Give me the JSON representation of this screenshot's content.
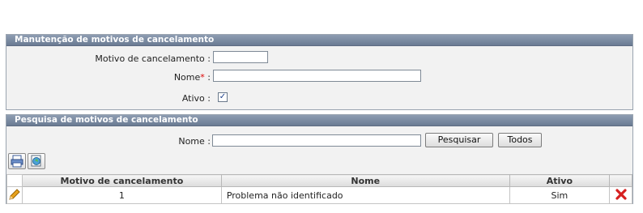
{
  "maintenance": {
    "title": "Manutenção de motivos de cancelamento",
    "motivo_label": "Motivo de cancelamento :",
    "motivo_value": "",
    "nome_label": "Nome",
    "required_mark": "*",
    "nome_colon": ":",
    "nome_value": "",
    "ativo_label": "Ativo :",
    "ativo_checked": true
  },
  "search": {
    "title": "Pesquisa de motivos de cancelamento",
    "nome_label": "Nome :",
    "nome_value": "",
    "search_button": "Pesquisar",
    "all_button": "Todos"
  },
  "toolbar": {
    "icons": [
      "print-icon",
      "export-icon"
    ]
  },
  "table": {
    "headers": [
      "Motivo de cancelamento",
      "Nome",
      "Ativo"
    ],
    "rows": [
      {
        "motivo": "1",
        "nome": "Problema não identificado",
        "ativo": "Sim"
      }
    ]
  },
  "colors": {
    "panel_header": "#7a8aa2",
    "delete_red": "#d62020",
    "edit_pencil": "#e8a21c"
  }
}
